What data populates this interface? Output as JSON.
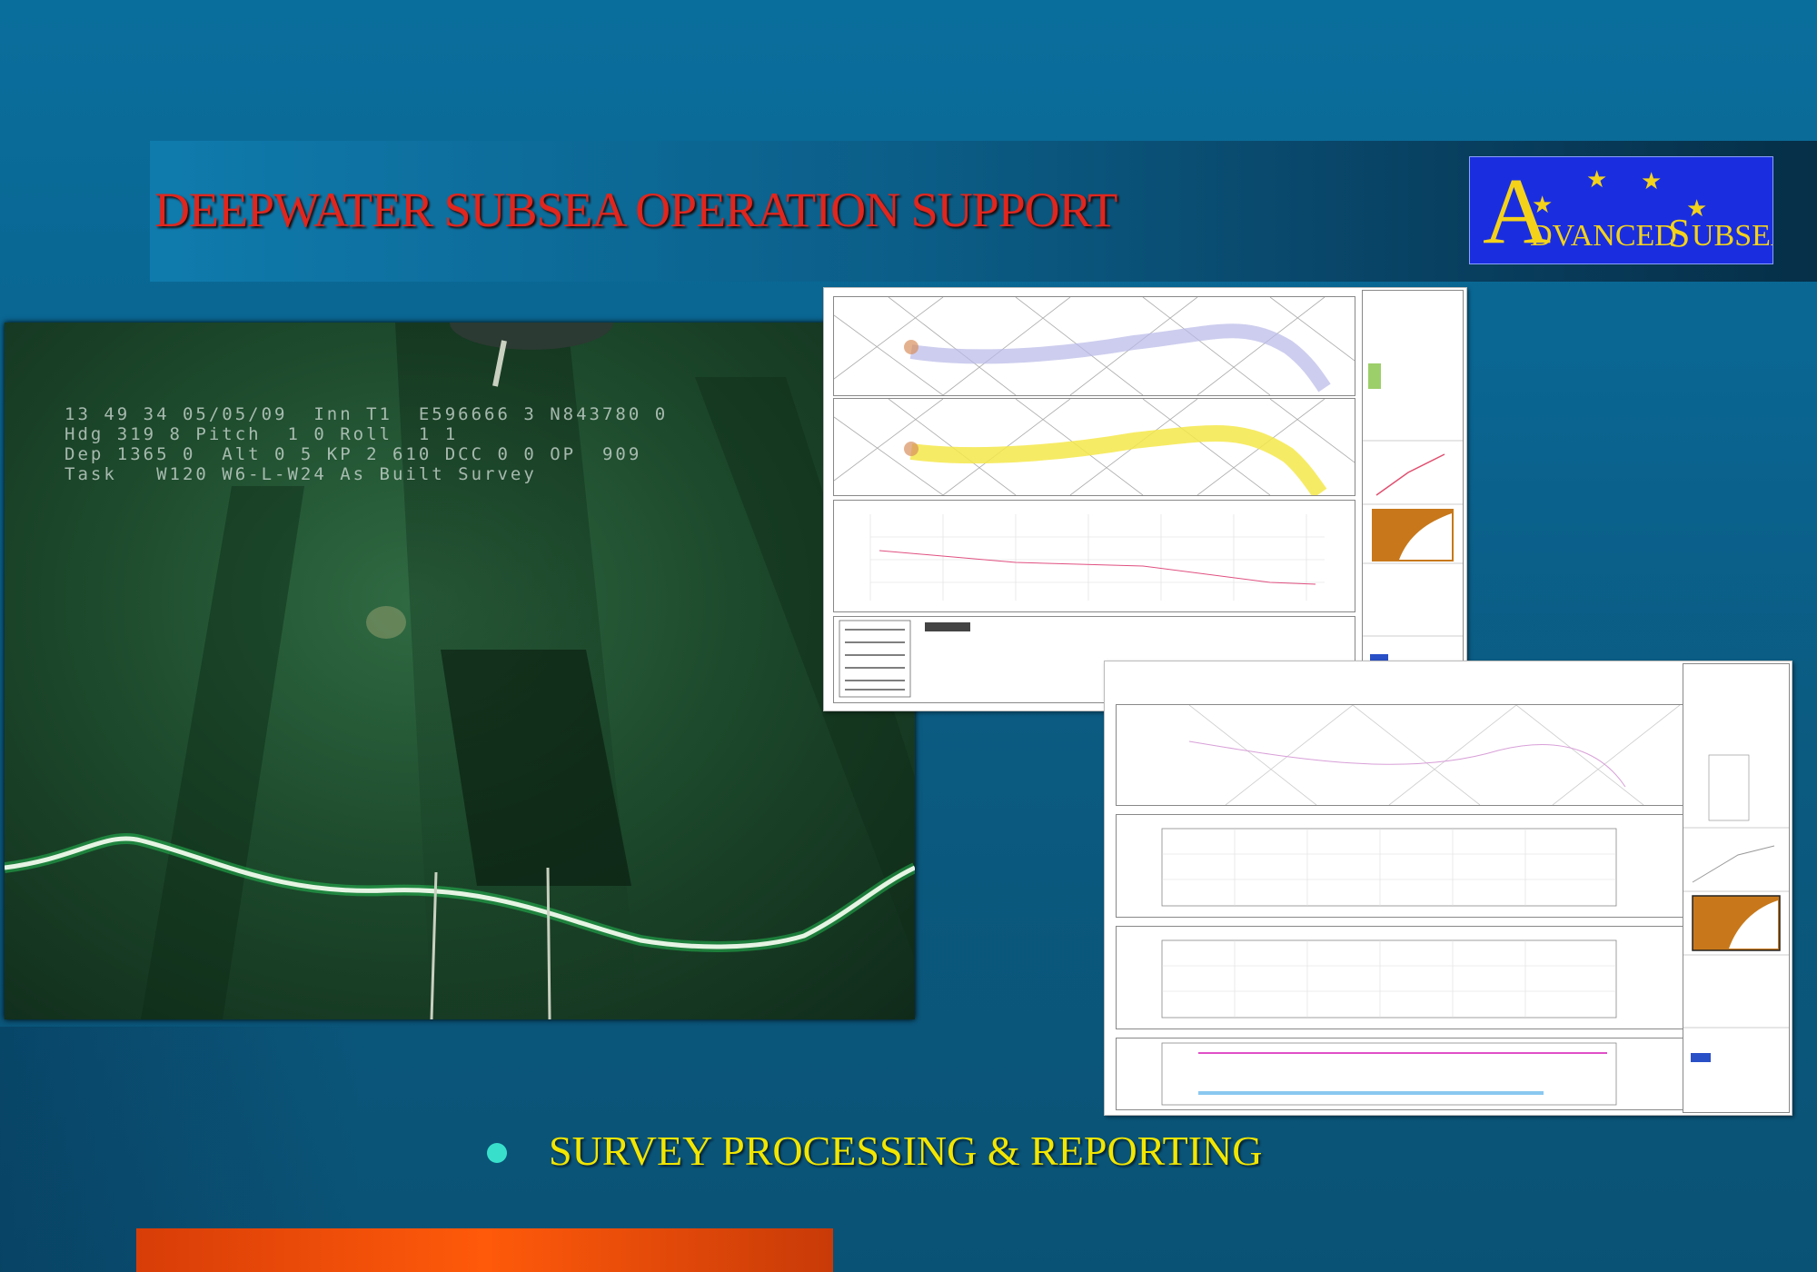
{
  "slide": {
    "title": "DEEPWATER SUBSEA OPERATION  SUPPORT",
    "bullet": "SURVEY PROCESSING & REPORTING"
  },
  "logo": {
    "initial": "A",
    "word1_rest": "DVANCED",
    "word2_initial": "S",
    "word2_rest": "UBSEA"
  },
  "video_overlay": {
    "line1": "13 49 34 05/05/09  Inn T1  E596666 3 N843780 0",
    "line2": "Hdg 319 8 Pitch  1 0 Roll  1 1",
    "line3": "Dep 1365 0  Alt 0 5 KP 2 610 DCC 0 0 OP  909",
    "line4": "Task   W120 W6-L-W24 As Built Survey"
  },
  "colors": {
    "title_red": "#e0261e",
    "logo_blue": "#1a2ee0",
    "logo_gold": "#f4d21a",
    "bullet_yellow": "#f2e600",
    "bullet_dot": "#38e0cc",
    "bar_orange": "#ff5a0a"
  }
}
